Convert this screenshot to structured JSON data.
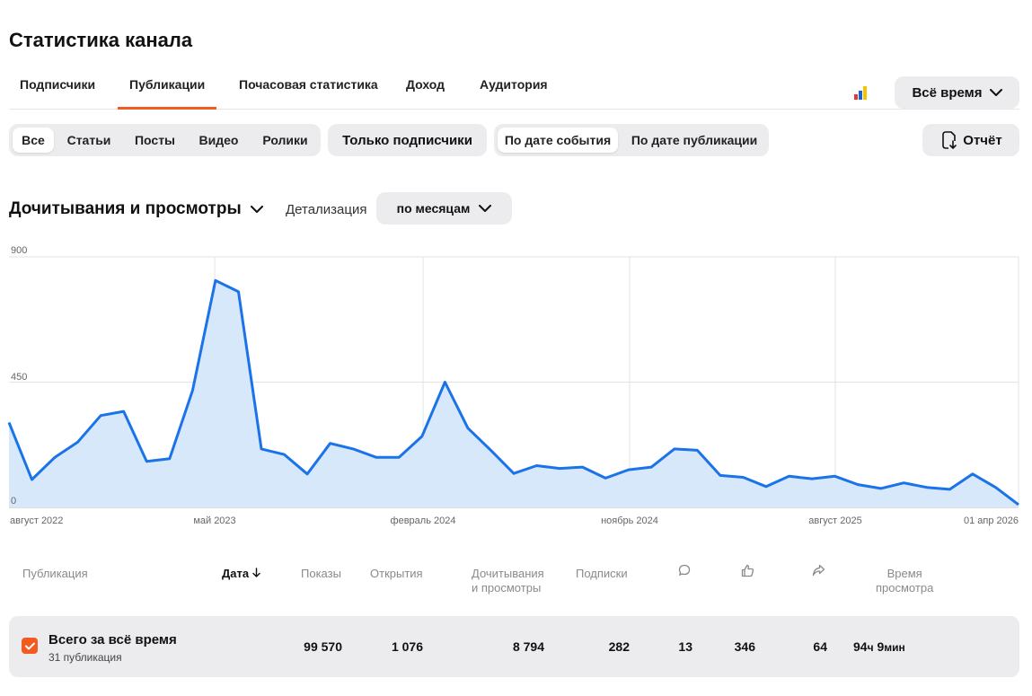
{
  "page": {
    "title": "Статистика канала"
  },
  "tabs": [
    {
      "label": "Подписчики",
      "active": false
    },
    {
      "label": "Публикации",
      "active": true
    },
    {
      "label": "Почасовая статистика",
      "active": false
    },
    {
      "label": "Доход",
      "active": false
    },
    {
      "label": "Аудитория",
      "active": false
    }
  ],
  "period": {
    "label": "Всё время"
  },
  "filters": {
    "types": [
      "Все",
      "Статьи",
      "Посты",
      "Видео",
      "Ролики"
    ],
    "types_selected": "Все",
    "subscribers_only": "Только подписчики",
    "date_modes": [
      "По дате события",
      "По дате публикации"
    ],
    "date_mode_selected": "По дате события",
    "report": "Отчёт"
  },
  "metric": {
    "title": "Дочитывания и просмотры",
    "detail_label": "Детализация",
    "detail_value": "по месяцам"
  },
  "chart_data": {
    "type": "area",
    "ylim": [
      0,
      900
    ],
    "y_ticks": [
      "900",
      "450",
      "0"
    ],
    "x_tick_labels": [
      "август 2022",
      "май 2023",
      "февраль 2024",
      "ноябрь 2024",
      "август 2025",
      "01 апр 2026"
    ],
    "color": "#1a73e8",
    "fill": "#d7e8fb",
    "grid": true,
    "values": [
      305,
      100,
      180,
      235,
      330,
      345,
      165,
      175,
      420,
      815,
      775,
      210,
      190,
      120,
      230,
      210,
      180,
      180,
      255,
      450,
      285,
      205,
      122,
      150,
      140,
      145,
      105,
      135,
      145,
      210,
      205,
      115,
      108,
      75,
      112,
      103,
      112,
      82,
      68,
      88,
      72,
      65,
      120,
      72,
      10
    ]
  },
  "table": {
    "headers": {
      "publication": "Публикация",
      "date": "Дата",
      "impressions": "Показы",
      "opens": "Открытия",
      "reads_line1": "Дочитывания",
      "reads_line2": "и просмотры",
      "subs": "Подписки",
      "time_line1": "Время",
      "time_line2": "просмотра"
    },
    "total": {
      "title": "Всего за всё время",
      "subtitle": "31 публикация",
      "impressions": "99 570",
      "opens": "1 076",
      "reads": "8 794",
      "subs": "282",
      "comments": "13",
      "likes": "346",
      "shares": "64",
      "time_h": "94",
      "time_h_unit": "ч",
      "time_m": "9",
      "time_m_unit": "мин"
    }
  }
}
